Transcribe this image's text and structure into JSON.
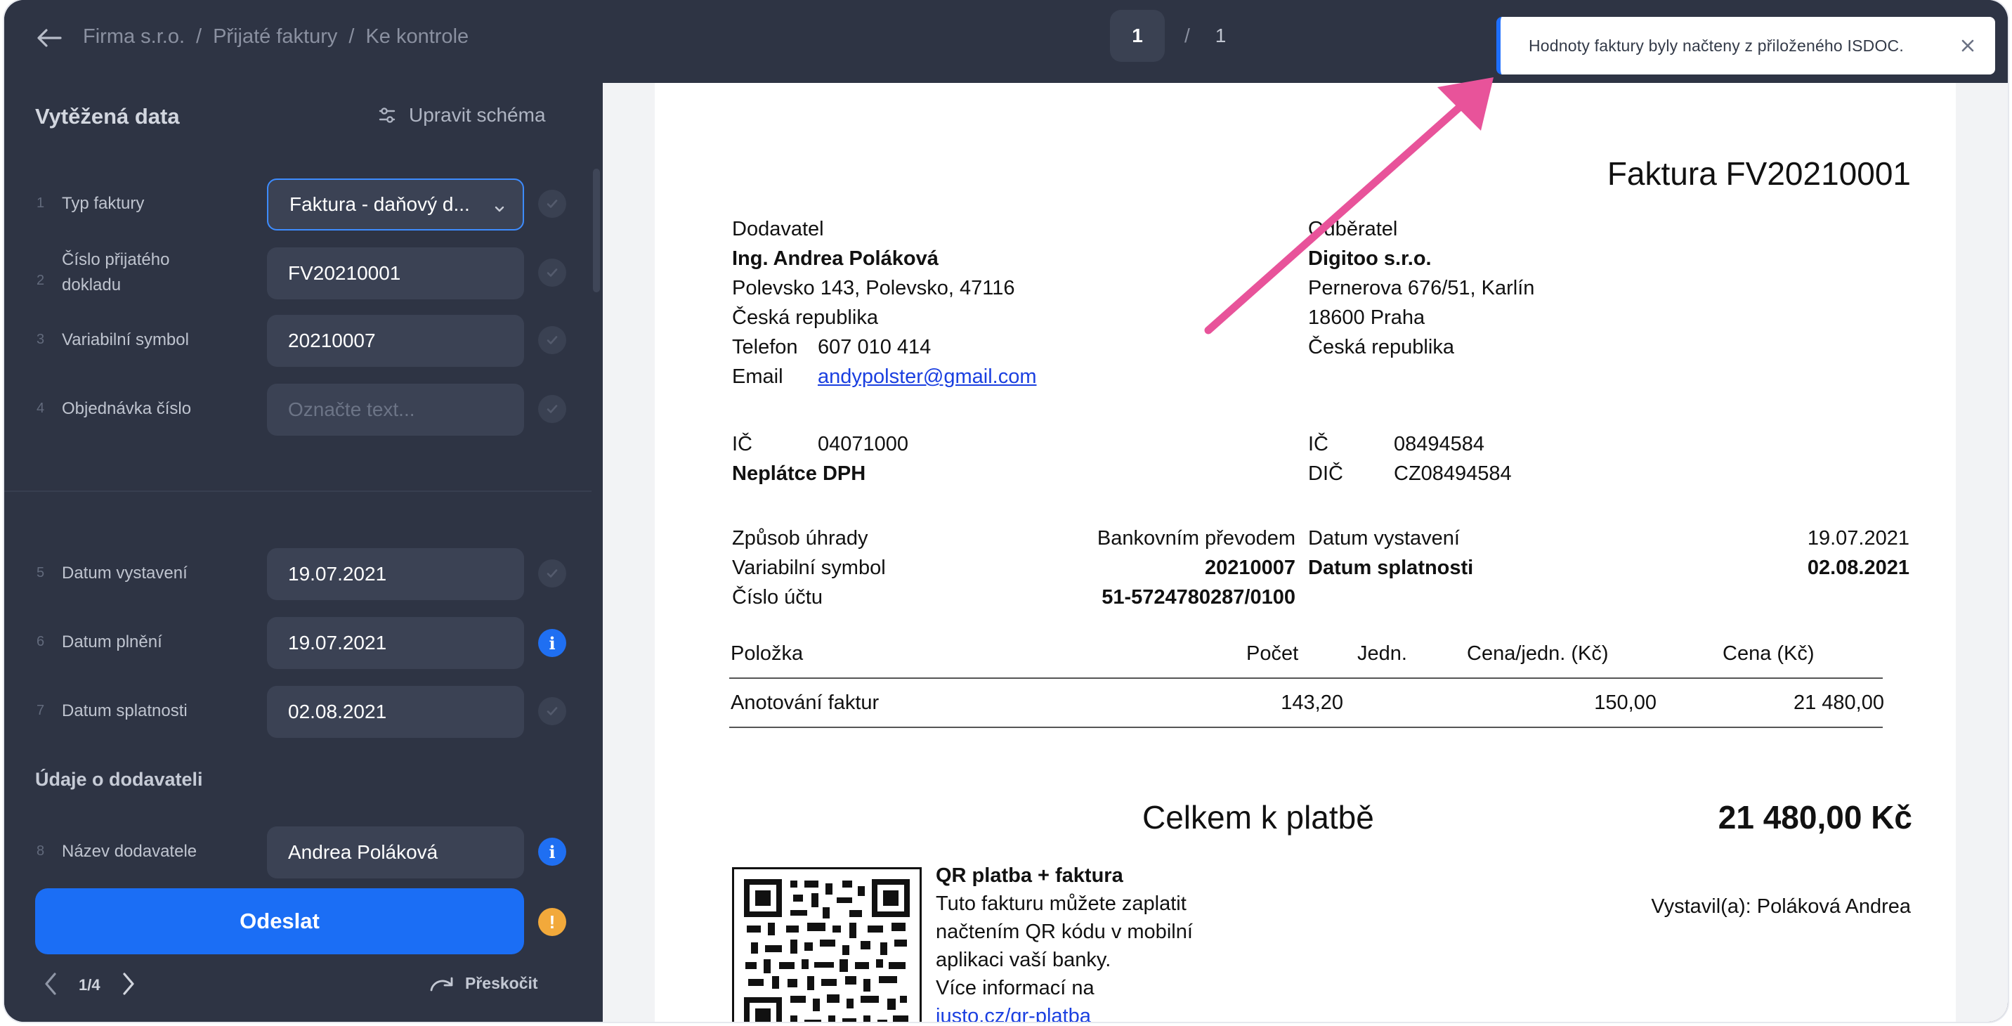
{
  "breadcrumb": [
    "Firma s.r.o.",
    "Přijaté faktury",
    "Ke kontrole"
  ],
  "breadcrumb_sep": "/",
  "pager": {
    "current": "1",
    "slash": "/",
    "total": "1"
  },
  "toast": {
    "message": "Hodnoty faktury byly načteny z přiloženého ISDOC."
  },
  "panel": {
    "title": "Vytěžená data",
    "edit_schema": "Upravit schéma",
    "fields": [
      {
        "num": "1",
        "label": "Typ faktury",
        "value": "Faktura - daňový d...",
        "placeholder": "",
        "status": "check"
      },
      {
        "num": "2",
        "label": "Číslo přijatého dokladu",
        "value": "FV20210001",
        "placeholder": "",
        "status": "check"
      },
      {
        "num": "3",
        "label": "Variabilní symbol",
        "value": "20210007",
        "placeholder": "",
        "status": "check"
      },
      {
        "num": "4",
        "label": "Objednávka číslo",
        "value": "",
        "placeholder": "Označte text...",
        "status": "check"
      },
      {
        "num": "5",
        "label": "Datum vystavení",
        "value": "19.07.2021",
        "placeholder": "",
        "status": "check"
      },
      {
        "num": "6",
        "label": "Datum plnění",
        "value": "19.07.2021",
        "placeholder": "",
        "status": "info"
      },
      {
        "num": "7",
        "label": "Datum splatnosti",
        "value": "02.08.2021",
        "placeholder": "",
        "status": "check"
      },
      {
        "num": "8",
        "label": "Název dodavatele",
        "value": "Andrea Poláková",
        "placeholder": "",
        "status": "info"
      }
    ],
    "section_supplier": "Údaje o dodavateli",
    "info_glyph": "i",
    "warn_glyph": "!",
    "submit_label": "Odeslat",
    "nav_count": "1/4",
    "skip_label": "Přeskočit"
  },
  "invoice": {
    "title": "Faktura FV20210001",
    "supplier": {
      "heading": "Dodavatel",
      "name": "Ing. Andrea Poláková",
      "address": "Polevsko 143, Polevsko, 47116",
      "country": "Česká republika",
      "phone_label": "Telefon",
      "phone": "607 010 414",
      "email_label": "Email",
      "email": "andypolster@gmail.com",
      "ic_label": "IČ",
      "ic": "04071000",
      "vat_note": "Neplátce DPH"
    },
    "customer": {
      "heading": "Odběratel",
      "name": "Digitoo s.r.o.",
      "address": "Pernerova 676/51, Karlín",
      "city": "18600 Praha",
      "country": "Česká republika",
      "ic_label": "IČ",
      "ic": "08494584",
      "dic_label": "DIČ",
      "dic": "CZ08494584"
    },
    "payment": {
      "method_label": "Způsob úhrady",
      "method": "Bankovním převodem",
      "vs_label": "Variabilní symbol",
      "vs": "20210007",
      "account_label": "Číslo účtu",
      "account": "51-5724780287/0100",
      "issued_label": "Datum vystavení",
      "issued": "19.07.2021",
      "due_label": "Datum splatnosti",
      "due": "02.08.2021"
    },
    "table": {
      "headers": [
        "Položka",
        "Počet",
        "Jedn.",
        "Cena/jedn. (Kč)",
        "Cena (Kč)"
      ],
      "rows": [
        {
          "item": "Anotování faktur",
          "qty": "143,20",
          "unit": "",
          "unit_price": "150,00",
          "price": "21 480,00"
        }
      ]
    },
    "total_label": "Celkem k platbě",
    "total_value": "21 480,00 Kč",
    "qr": {
      "title": "QR platba + faktura",
      "lines": [
        "Tuto fakturu můžete zaplatit",
        "načtením QR kódu v mobilní",
        "aplikaci vaší banky.",
        "Více informací na"
      ],
      "link": "iusto.cz/qr-platba"
    },
    "issued_by": "Vystavil(a): Poláková Andrea"
  },
  "colors": {
    "accent": "#1b6ef5",
    "panel_bg": "#2e3444",
    "warning": "#f2a93b",
    "annotation_arrow": "#e8539a"
  }
}
